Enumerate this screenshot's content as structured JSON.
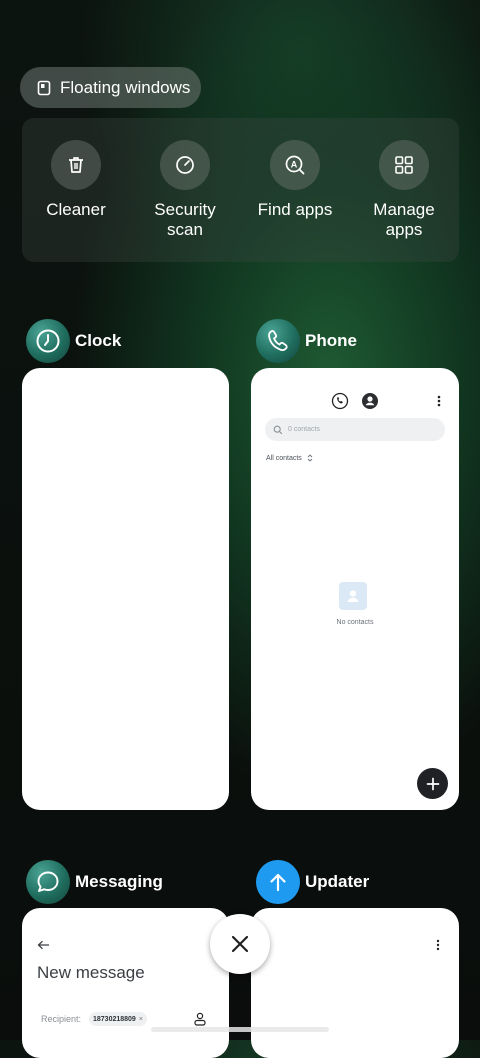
{
  "floating_windows": {
    "label": "Floating windows"
  },
  "tools": [
    {
      "label": "Cleaner",
      "icon": "trash-icon"
    },
    {
      "label": "Security scan",
      "icon": "security-scan-icon"
    },
    {
      "label": "Find apps",
      "icon": "find-apps-icon"
    },
    {
      "label": "Manage apps",
      "icon": "grid-icon"
    }
  ],
  "apps": {
    "clock": {
      "name": "Clock",
      "icon": "clock-icon"
    },
    "phone": {
      "name": "Phone",
      "icon": "phone-icon",
      "search_placeholder": "0 contacts",
      "filter_label": "All contacts",
      "empty_text": "No contacts"
    },
    "messaging": {
      "name": "Messaging",
      "icon": "chat-bubble-icon",
      "title": "New message",
      "recipient_label": "Recipient:",
      "recipient_value": "18730218809",
      "chip_remove": "×"
    },
    "updater": {
      "name": "Updater",
      "icon": "arrow-up-icon"
    }
  },
  "colors": {
    "updater_icon_bg": "#1e9bf0",
    "fab_bg": "#202124"
  }
}
